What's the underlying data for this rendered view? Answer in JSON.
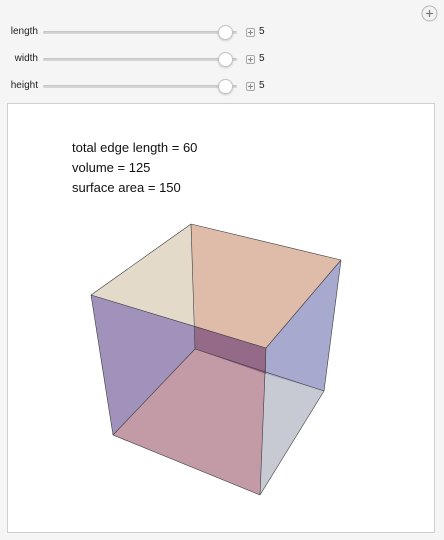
{
  "controls": [
    {
      "label": "length",
      "value": "5",
      "fraction": 1.0
    },
    {
      "label": "width",
      "value": "5",
      "fraction": 1.0
    },
    {
      "label": "height",
      "value": "5",
      "fraction": 1.0
    }
  ],
  "info": {
    "edge_length": "total edge length = 60",
    "volume": "volume = 125",
    "surface_area": "surface area = 150"
  },
  "icons": {
    "reset": "reset-plus-icon",
    "step": "plus-icon"
  },
  "colors": {
    "face_left": "#8f7fae",
    "face_top_left": "#e2d8c6",
    "face_top_right": "#dcb4a0",
    "face_right": "#a4a4cc",
    "face_bottom": "#b88a96",
    "face_bottom_right": "#c8cfd8"
  }
}
